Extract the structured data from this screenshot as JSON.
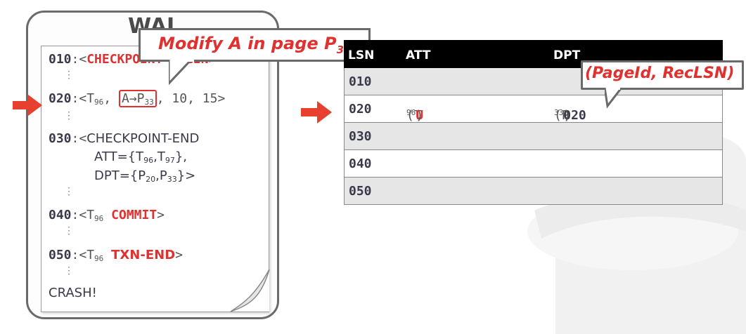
{
  "wal": {
    "title": "WAL",
    "entries": [
      {
        "lsn": "010",
        "sep": ":<",
        "text": "CHECKPOINT-BEGIN>"
      },
      {
        "lsn": "020",
        "sep": ":<",
        "t": "T",
        "t_sub": "96",
        "mid": ", ",
        "rec": "A→P",
        "rec_sub": "33",
        "tail": ", 10, 15>"
      },
      {
        "lsn": "030",
        "sep": ":<",
        "text": "CHECKPOINT-END"
      },
      {
        "lsn": "040",
        "sep": ":<",
        "t": "T",
        "t_sub": "96",
        "kw": "COMMIT",
        "close": ">"
      },
      {
        "lsn": "050",
        "sep": ":<",
        "t": "T",
        "t_sub": "96",
        "kw": "TXN-END",
        "close": ">"
      }
    ],
    "att_line": {
      "prefix": "ATT={",
      "t1": "T",
      "t1_sub": "96",
      "comma": ",",
      "t2": "T",
      "t2_sub": "97",
      "suffix": "},"
    },
    "dpt_line": {
      "prefix": "DPT={",
      "p1": "P",
      "p1_sub": "20",
      "comma": ",",
      "p2": "P",
      "p2_sub": "33",
      "suffix": "}>"
    },
    "crash": "CRASH!"
  },
  "callout_modify": {
    "text": "Modify A in page P",
    "sub": "33"
  },
  "table": {
    "headers": [
      "LSN",
      "ATT",
      "DPT"
    ],
    "rows": [
      {
        "lsn": "010",
        "att": "",
        "dpt": ""
      },
      {
        "lsn": "020",
        "att_open": "(T",
        "att_sub": "96",
        "att_comma": ",",
        "att_status": "U",
        "att_close": ")",
        "dpt_open": "(P",
        "dpt_sub": "33",
        "dpt_comma": ",",
        "dpt_lsn": "020",
        "dpt_close": ")"
      },
      {
        "lsn": "030",
        "att": "",
        "dpt": ""
      },
      {
        "lsn": "040",
        "att": "",
        "dpt": ""
      },
      {
        "lsn": "050",
        "att": "",
        "dpt": ""
      }
    ]
  },
  "callout_dpt": {
    "text": "(PageId, RecLSN)"
  },
  "colors": {
    "accent": "#e03030",
    "header_bg": "#000000",
    "row_alt": "#e6e6e6"
  }
}
